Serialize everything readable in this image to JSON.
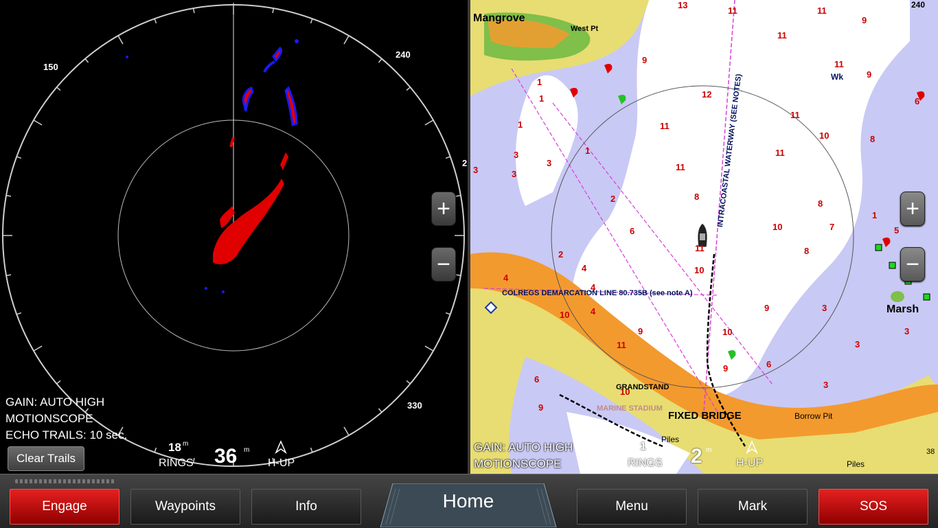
{
  "radar": {
    "bearing_labels": [
      "150",
      "240",
      "330",
      "2"
    ],
    "status": [
      "GAIN: AUTO HIGH",
      "MOTIONSCOPE",
      "ECHO TRAILS: 10 sec."
    ],
    "clear_trails_label": "Clear Trails",
    "rings_value": "18",
    "rings_unit": "m",
    "rings_label": "RINGS",
    "range_value": "36",
    "range_unit": "m",
    "orientation_label": "H-UP",
    "zoom_in": "+",
    "zoom_out": "−"
  },
  "chart": {
    "status": [
      "GAIN: AUTO HIGH",
      "MOTIONSCOPE"
    ],
    "rings_value": "1",
    "rings_unit": "m",
    "rings_label": "RINGS",
    "range_value": "2",
    "range_unit": "m",
    "orientation_label": "H-UP",
    "range_ring_corner": "240",
    "edge_value": "38",
    "zoom_in": "+",
    "zoom_out": "−",
    "labels": {
      "mangrove": "Mangrove",
      "west_pt": "West Pt",
      "wk": "Wk",
      "intracoastal": "INTRACOASTAL WATERWAY (SEE NOTES)",
      "colregs": "COLREGS DEMARCATION LINE 80.735B (see note A)",
      "marsh": "Marsh",
      "grandstand": "GRANDSTAND",
      "marine_stadium": "MARINE STADIUM",
      "fixed_bridge": "FIXED BRIDGE",
      "borrow_pit": "Borrow Pit",
      "piles_1": "Piles",
      "piles_2": "Piles"
    },
    "depths": [
      "13",
      "11",
      "11",
      "9",
      "11",
      "11",
      "9",
      "9",
      "1",
      "1",
      "1",
      "11",
      "12",
      "11",
      "11",
      "10",
      "8",
      "11",
      "6",
      "3",
      "3",
      "1",
      "2",
      "11",
      "8",
      "8",
      "6",
      "3",
      "1",
      "10",
      "7",
      "5",
      "4",
      "2",
      "4",
      "4",
      "10",
      "10",
      "8",
      "4",
      "9",
      "10",
      "9",
      "3",
      "3",
      "9",
      "11",
      "10",
      "6",
      "3",
      "3",
      "6",
      "9",
      "3"
    ]
  },
  "colors": {
    "water_deep": "#ffffff",
    "water_shallow": "#c9c9f5",
    "land": "#e8dd72",
    "urban": "#f39a2e",
    "vegetation": "#7fbf4a",
    "depth_text": "#cc0000",
    "sos_red": "#d10000"
  },
  "bottom_bar": {
    "engage": "Engage",
    "waypoints": "Waypoints",
    "info": "Info",
    "home": "Home",
    "menu": "Menu",
    "mark": "Mark",
    "sos": "SOS"
  }
}
